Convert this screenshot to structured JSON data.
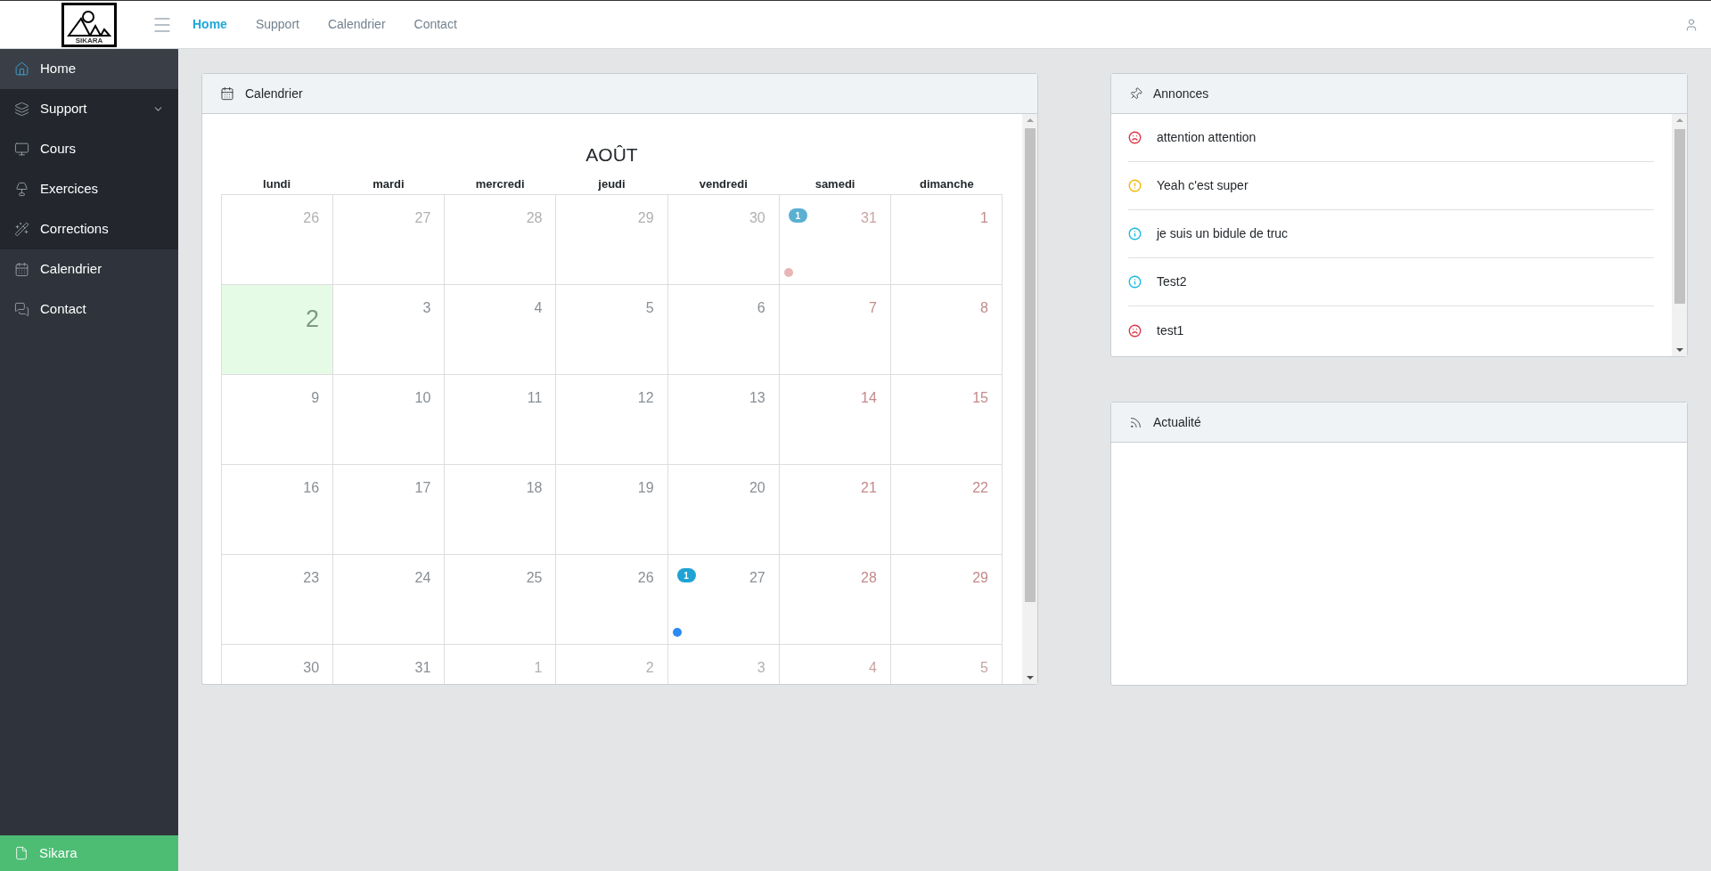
{
  "header": {
    "logo_text": "SIKARA",
    "nav": [
      {
        "label": "Home",
        "selected": true
      },
      {
        "label": "Support",
        "selected": false
      },
      {
        "label": "Calendrier",
        "selected": false
      },
      {
        "label": "Contact",
        "selected": false
      }
    ]
  },
  "sidebar": {
    "items": [
      {
        "label": "Home",
        "selected": true
      },
      {
        "label": "Support",
        "selected": false,
        "expanded": true,
        "children": [
          {
            "label": "Cours",
            "selected": false
          },
          {
            "label": "Exercices",
            "selected": false
          },
          {
            "label": "Corrections",
            "selected": false
          }
        ]
      },
      {
        "label": "Calendrier",
        "selected": false
      },
      {
        "label": "Contact",
        "selected": false
      }
    ],
    "footer": "Sikara"
  },
  "calendar": {
    "title": "Calendrier",
    "month": "AOÛT",
    "weekdays": [
      "lundi",
      "mardi",
      "mercredi",
      "jeudi",
      "vendredi",
      "samedi",
      "dimanche"
    ],
    "weeks": [
      [
        {
          "day": "26",
          "outside": true,
          "today": false
        },
        {
          "day": "27",
          "outside": true,
          "today": false
        },
        {
          "day": "28",
          "outside": true,
          "today": false
        },
        {
          "day": "29",
          "outside": true,
          "today": false
        },
        {
          "day": "30",
          "outside": true,
          "today": false
        },
        {
          "day": "31",
          "outside": true,
          "today": false,
          "badge": "1",
          "color": "#e8b4b4"
        },
        {
          "day": "1",
          "outside": false,
          "today": false
        }
      ],
      [
        {
          "day": "2",
          "outside": false,
          "today": true
        },
        {
          "day": "3",
          "outside": false,
          "today": false
        },
        {
          "day": "4",
          "outside": false,
          "today": false
        },
        {
          "day": "5",
          "outside": false,
          "today": false
        },
        {
          "day": "6",
          "outside": false,
          "today": false
        },
        {
          "day": "7",
          "outside": false,
          "today": false
        },
        {
          "day": "8",
          "outside": false,
          "today": false
        }
      ],
      [
        {
          "day": "9",
          "outside": false,
          "today": false
        },
        {
          "day": "10",
          "outside": false,
          "today": false
        },
        {
          "day": "11",
          "outside": false,
          "today": false
        },
        {
          "day": "12",
          "outside": false,
          "today": false
        },
        {
          "day": "13",
          "outside": false,
          "today": false
        },
        {
          "day": "14",
          "outside": false,
          "today": false
        },
        {
          "day": "15",
          "outside": false,
          "today": false
        }
      ],
      [
        {
          "day": "16",
          "outside": false,
          "today": false
        },
        {
          "day": "17",
          "outside": false,
          "today": false
        },
        {
          "day": "18",
          "outside": false,
          "today": false
        },
        {
          "day": "19",
          "outside": false,
          "today": false
        },
        {
          "day": "20",
          "outside": false,
          "today": false
        },
        {
          "day": "21",
          "outside": false,
          "today": false
        },
        {
          "day": "22",
          "outside": false,
          "today": false
        }
      ],
      [
        {
          "day": "23",
          "outside": false,
          "today": false
        },
        {
          "day": "24",
          "outside": false,
          "today": false
        },
        {
          "day": "25",
          "outside": false,
          "today": false
        },
        {
          "day": "26",
          "outside": false,
          "today": false
        },
        {
          "day": "27",
          "outside": false,
          "today": false,
          "badge": "1",
          "color": "#2a8bf2"
        },
        {
          "day": "28",
          "outside": false,
          "today": false
        },
        {
          "day": "29",
          "outside": false,
          "today": false
        }
      ],
      [
        {
          "day": "30",
          "outside": false,
          "today": false
        },
        {
          "day": "31",
          "outside": false,
          "today": false
        },
        {
          "day": "1",
          "outside": true,
          "today": false
        },
        {
          "day": "2",
          "outside": true,
          "today": false
        },
        {
          "day": "3",
          "outside": true,
          "today": false
        },
        {
          "day": "4",
          "outside": true,
          "today": false
        },
        {
          "day": "5",
          "outside": true,
          "today": false
        }
      ]
    ]
  },
  "announcements": {
    "title": "Annonces",
    "items": [
      {
        "kind": "danger",
        "text": "attention attention"
      },
      {
        "kind": "warning",
        "text": "Yeah c'est super"
      },
      {
        "kind": "info",
        "text": "je suis un bidule de truc"
      },
      {
        "kind": "info",
        "text": "Test2"
      },
      {
        "kind": "danger",
        "text": "test1"
      }
    ]
  },
  "news": {
    "title": "Actualité"
  }
}
